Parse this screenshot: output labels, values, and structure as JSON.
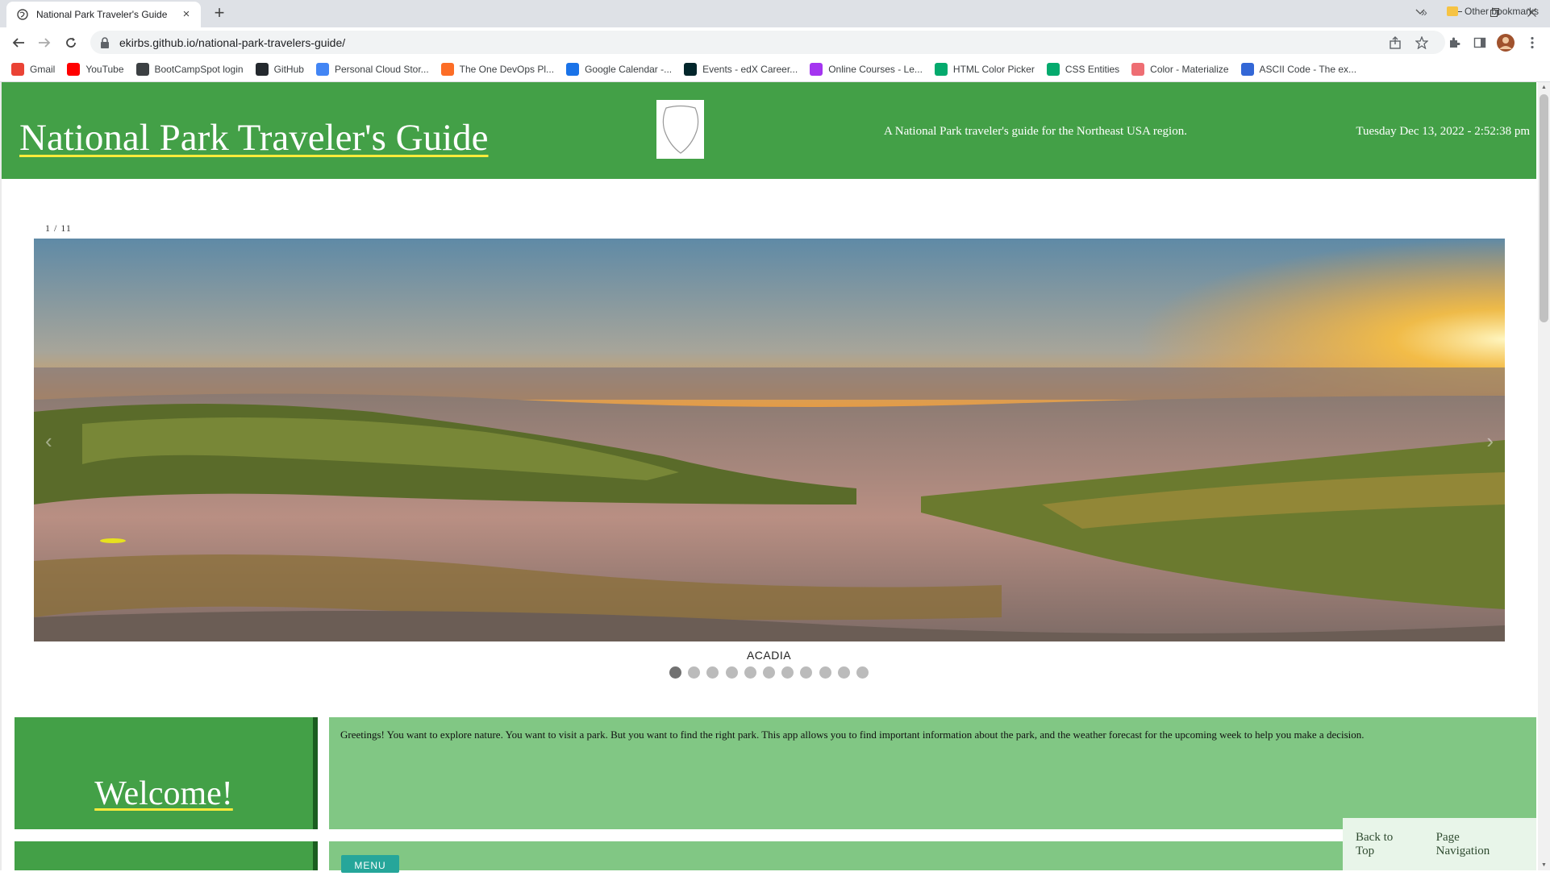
{
  "browser": {
    "tab_title": "National Park Traveler's Guide",
    "tab_close": "×",
    "new_tab": "+",
    "url": "ekirbs.github.io/national-park-travelers-guide/",
    "bookmarks": [
      {
        "label": "Gmail",
        "icon": "gmail-icon",
        "color": "#ea4335"
      },
      {
        "label": "YouTube",
        "icon": "youtube-icon",
        "color": "#ff0000"
      },
      {
        "label": "BootCampSpot login",
        "icon": "bootcampspot-icon",
        "color": "#3c4043"
      },
      {
        "label": "GitHub",
        "icon": "github-icon",
        "color": "#24292e"
      },
      {
        "label": "Personal Cloud Stor...",
        "icon": "google-icon",
        "color": "#4285f4"
      },
      {
        "label": "The One DevOps Pl...",
        "icon": "gitlab-icon",
        "color": "#fc6d26"
      },
      {
        "label": "Google Calendar -...",
        "icon": "calendar-icon",
        "color": "#1a73e8"
      },
      {
        "label": "Events - edX Career...",
        "icon": "edx-icon",
        "color": "#02262b"
      },
      {
        "label": "Online Courses - Le...",
        "icon": "udemy-icon",
        "color": "#a435f0"
      },
      {
        "label": "HTML Color Picker",
        "icon": "w3schools-icon",
        "color": "#04aa6d"
      },
      {
        "label": "CSS Entities",
        "icon": "w3schools-icon",
        "color": "#04aa6d"
      },
      {
        "label": "Color - Materialize",
        "icon": "materialize-icon",
        "color": "#ee6e73"
      },
      {
        "label": "ASCII Code - The ex...",
        "icon": "ascii-icon",
        "color": "#3367d6"
      }
    ],
    "bookmarks_more": "»",
    "other_bookmarks": "Other bookmarks"
  },
  "header": {
    "title": "National Park Traveler's Guide",
    "tagline": "A National Park traveler's guide for the Northeast USA region.",
    "datetime": "Tuesday Dec 13, 2022 - 2:52:38 pm"
  },
  "carousel": {
    "counter": "1 / 11",
    "caption": "ACADIA",
    "prev": "‹",
    "next": "›",
    "total_slides": 11,
    "active_slide": 1
  },
  "welcome": {
    "title": "Welcome!",
    "intro": "Greetings! You want to explore nature. You want to visit a park. But you want to find the right park. This app allows you to find important information about the park, and the weather forecast for the upcoming week to help you make a decision."
  },
  "menu": {
    "button": "MENU"
  },
  "floating_nav": {
    "back_to_top": "Back to Top",
    "page_navigation": "Page Navigation"
  },
  "colors": {
    "header_green": "#43a047",
    "light_green": "#81c784",
    "underline_yellow": "#ffeb3b",
    "menu_teal": "#26a69a"
  }
}
